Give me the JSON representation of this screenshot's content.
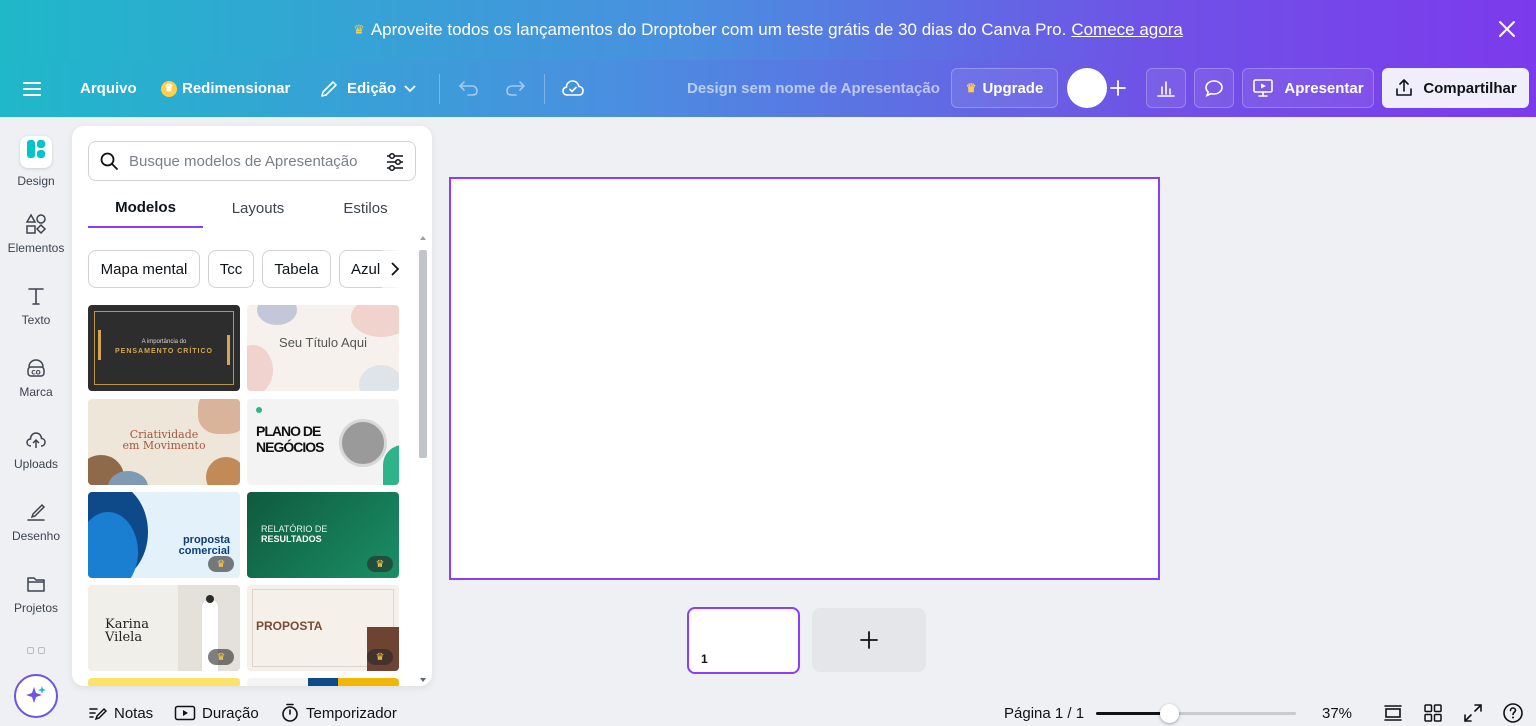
{
  "promo": {
    "text": "Aproveite todos os lançamentos do Droptober com um teste grátis de 30 dias do Canva Pro.",
    "link": "Comece agora"
  },
  "topbar": {
    "file": "Arquivo",
    "resize": "Redimensionar",
    "edit": "Edição",
    "design_name": "Design sem nome de Apresentação",
    "upgrade": "Upgrade",
    "present": "Apresentar",
    "share": "Compartilhar"
  },
  "rail": {
    "items": [
      {
        "label": "Design"
      },
      {
        "label": "Elementos"
      },
      {
        "label": "Texto"
      },
      {
        "label": "Marca"
      },
      {
        "label": "Uploads"
      },
      {
        "label": "Desenho"
      },
      {
        "label": "Projetos"
      }
    ]
  },
  "panel": {
    "search_placeholder": "Busque modelos de Apresentação",
    "tabs": [
      "Modelos",
      "Layouts",
      "Estilos"
    ],
    "chips": [
      "Mapa mental",
      "Tcc",
      "Tabela",
      "Azul"
    ],
    "templates": [
      {
        "line1": "A importância do",
        "line2": "PENSAMENTO CRÍTICO"
      },
      {
        "line1": "Seu Título Aqui"
      },
      {
        "line1": "Criatividade",
        "line2": "em Movimento"
      },
      {
        "line1": "PLANO DE",
        "line2": "NEGÓCIOS"
      },
      {
        "line1": "proposta",
        "line2": "comercial"
      },
      {
        "line1": "RELATÓRIO DE",
        "line2": "RESULTADOS"
      },
      {
        "line1": "Karina",
        "line2": "Vilela"
      },
      {
        "line1": "PROPOSTA"
      }
    ]
  },
  "pages": {
    "thumb_number": "1"
  },
  "bottom": {
    "notes": "Notas",
    "duration": "Duração",
    "timer": "Temporizador",
    "page_indicator": "Página 1 / 1",
    "zoom": "37%",
    "zoom_value": 0.37
  },
  "colors": {
    "accent": "#8b3dff",
    "crown": "#ffcf4a"
  }
}
